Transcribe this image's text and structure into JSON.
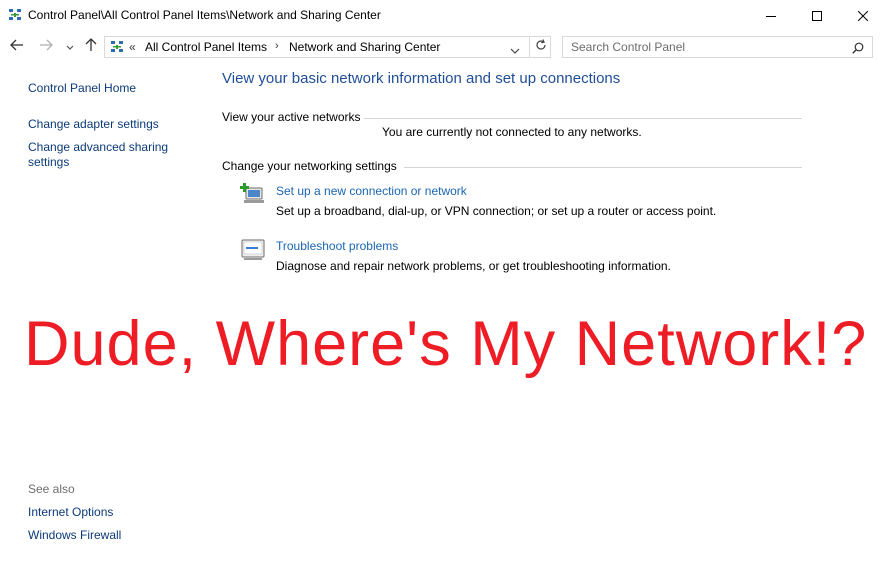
{
  "window": {
    "title": "Control Panel\\All Control Panel Items\\Network and Sharing Center",
    "icon": "network-icon"
  },
  "controls": {
    "minimize_icon": "minimize-icon",
    "maximize_icon": "maximize-icon",
    "close_icon": "close-icon"
  },
  "navigation": {
    "back_icon": "arrow-left-icon",
    "forward_icon": "arrow-right-icon",
    "recent_icon": "chevron-down-icon",
    "up_icon": "arrow-up-icon"
  },
  "address_bar": {
    "overflow": "«",
    "crumbs": [
      "All Control Panel Items",
      "Network and Sharing Center"
    ],
    "separator": "›"
  },
  "search": {
    "placeholder": "Search Control Panel"
  },
  "sidebar": {
    "home": "Control Panel Home",
    "items": [
      "Change adapter settings",
      "Change advanced sharing settings"
    ]
  },
  "see_also": {
    "heading": "See also",
    "links": [
      "Internet Options",
      "Windows Firewall"
    ]
  },
  "main": {
    "title": "View your basic network information and set up connections",
    "active_networks_heading": "View your active networks",
    "not_connected_text": "You are currently not connected to any networks.",
    "change_settings_heading": "Change your networking settings",
    "tasks": [
      {
        "link": "Set up a new connection or network",
        "description": "Set up a broadband, dial-up, or VPN connection; or set up a router or access point.",
        "icon": "new-connection-icon"
      },
      {
        "link": "Troubleshoot problems",
        "description": "Diagnose and repair network problems, or get troubleshooting information.",
        "icon": "troubleshoot-icon"
      }
    ]
  },
  "overlay_text": "Dude, Where's My Network!?",
  "colors": {
    "overlay": "#ee1c24",
    "link": "#1a66b3",
    "title": "#1f4e96"
  }
}
